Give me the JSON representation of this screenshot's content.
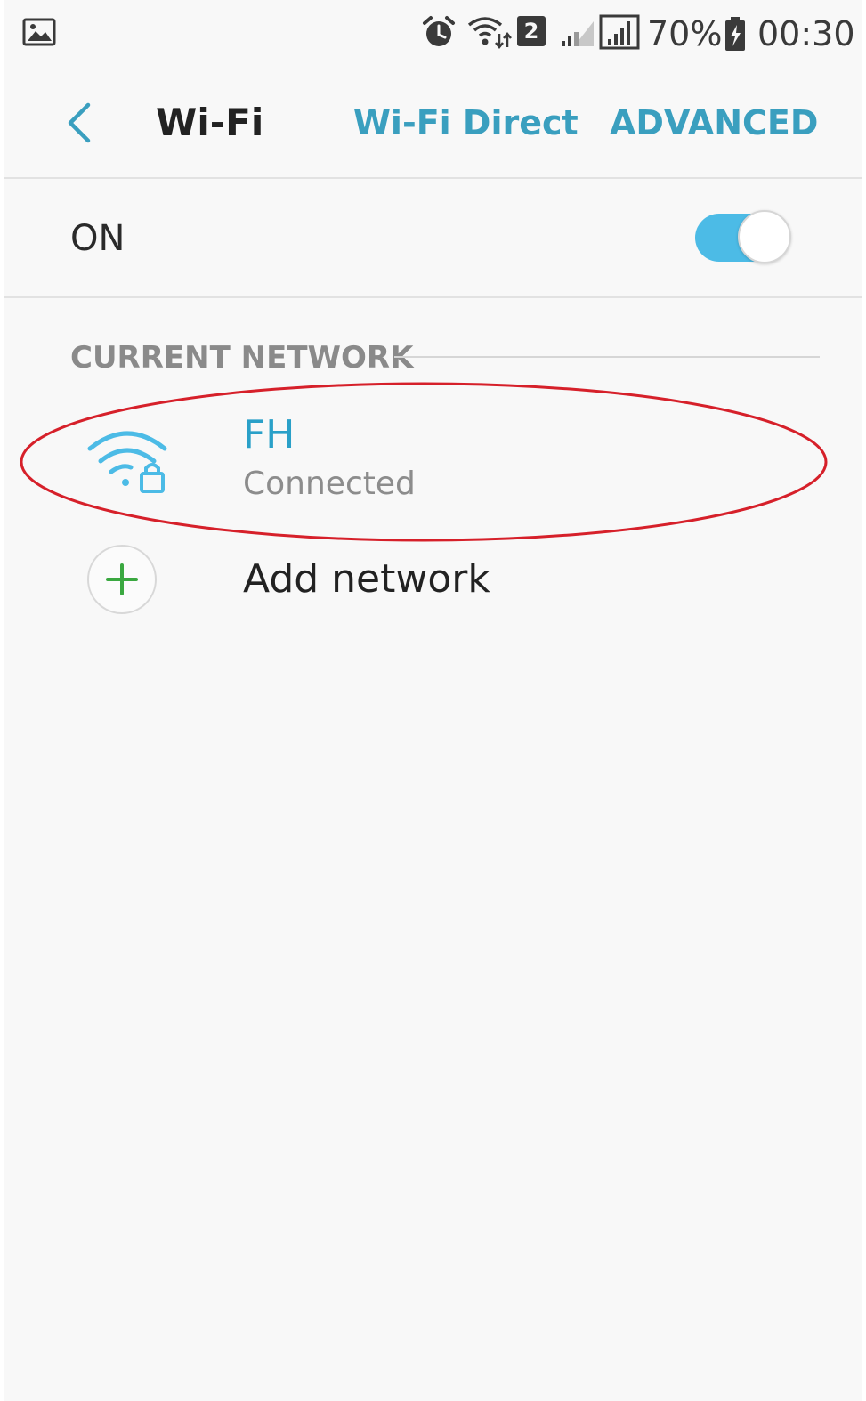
{
  "status_bar": {
    "icons": [
      "gallery-icon",
      "alarm-icon",
      "wifi-data-icon",
      "sim2-icon",
      "signal-weak-icon",
      "signal-icon",
      "battery-charging-icon"
    ],
    "sim_number": "2",
    "battery_percent": "70%",
    "time": "00:30"
  },
  "header": {
    "back_icon": "chevron-left-icon",
    "title": "Wi-Fi",
    "wifi_direct_label": "Wi-Fi Direct",
    "advanced_label": "ADVANCED"
  },
  "wifi_switch": {
    "label": "ON",
    "enabled": true,
    "accent_color": "#4cbbe6"
  },
  "current_network": {
    "section_title": "CURRENT NETWORK",
    "name": "FH",
    "status": "Connected",
    "icon": "wifi-lock-icon",
    "accent_color": "#2aa0c8",
    "highlight_color": "#d6202a"
  },
  "add_network": {
    "icon": "plus-icon",
    "label": "Add network",
    "icon_color": "#3aa840"
  }
}
